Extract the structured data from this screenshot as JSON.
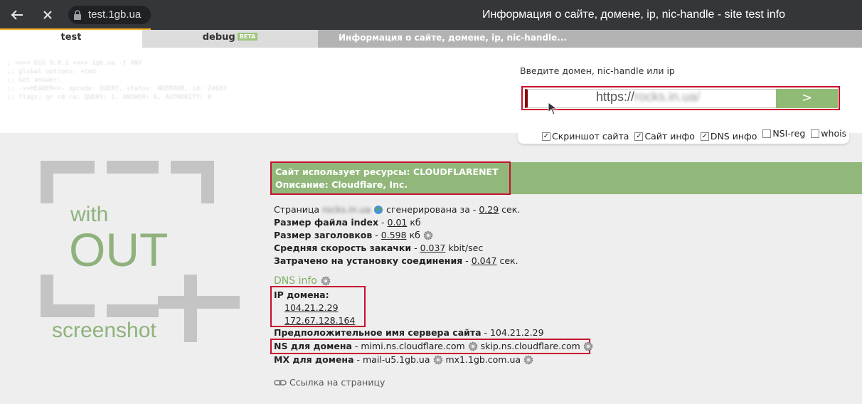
{
  "browser": {
    "back_icon": "arrow-left-icon",
    "close_icon": "close-icon",
    "lock_icon": "lock-icon",
    "url": "test.1gb.ua",
    "window_title": "Информация о сайте, домене, ip, nic-handle - site test info"
  },
  "tabs": {
    "test": "test",
    "debug": "debug",
    "beta": "BETA",
    "info": "Информация о сайте, домене, ip, nic-handle..."
  },
  "log_lines": [
    "; <<>> DiG 9.8.1 <<>> 1gb.ua -t ANY",
    ";; global options: +cmd",
    ";; Got answer:",
    ";; ->>HEADER<<- opcode: QUERY, status: NOERROR, id: 24683",
    ";; flags: qr rd ra; QUERY: 1, ANSWER: 6, AUTHORITY: 0"
  ],
  "search": {
    "label": "Введите домен, nic-handle или ip",
    "prefix": "https://",
    "domain": "rocks.in.ua/",
    "go_label": ">"
  },
  "options": [
    {
      "label": "Скриншот сайта",
      "checked": true
    },
    {
      "label": "Сайт инфо",
      "checked": true
    },
    {
      "label": "DNS инфо",
      "checked": true
    },
    {
      "label": "NSI-reg",
      "checked": false
    },
    {
      "label": "whois",
      "checked": false
    }
  ],
  "logo": {
    "with": "with",
    "out": "OUT",
    "screenshot": "screenshot"
  },
  "banner": {
    "resources": "Сайт использует ресурсы: CLOUDFLARENET",
    "description": "Описание: Cloudflare, Inc."
  },
  "stats": {
    "page_prefix": "Страница",
    "page_domain": "rocks.in.ua",
    "page_generated": "сгенерирована за -",
    "page_time": "0.29",
    "page_unit": "сек.",
    "index_label": "Размер файла index",
    "index_value": "0.01",
    "index_unit": "кб",
    "headers_label": "Размер заголовков",
    "headers_value": "0.598",
    "headers_unit": "кб",
    "speed_label": "Средняя скорость закачки",
    "speed_value": "0.037",
    "speed_unit": "kbit/sec",
    "connect_label": "Затрачено на установку соединения",
    "connect_value": "0.047",
    "connect_unit": "сек."
  },
  "dns": {
    "title": "DNS info",
    "ip_label": "IP домена:",
    "ips": [
      "104.21.2.29",
      "172.67.128.164"
    ],
    "server_label": "Предположительное имя сервера сайта",
    "server_value": "104.21.2.29",
    "ns_label": "NS для домена",
    "ns1": "mimi.ns.cloudflare.com",
    "ns2": "skip.ns.cloudflare.com",
    "mx_label": "MX для домена",
    "mx1": "mail-u5.1gb.ua",
    "mx2": "mx1.1gb.com.ua"
  },
  "link_page": "Ссылка на страницу",
  "colors": {
    "accent_green": "#91b87a",
    "highlight_red": "#c8102e",
    "load_bar": "#f0b323"
  }
}
